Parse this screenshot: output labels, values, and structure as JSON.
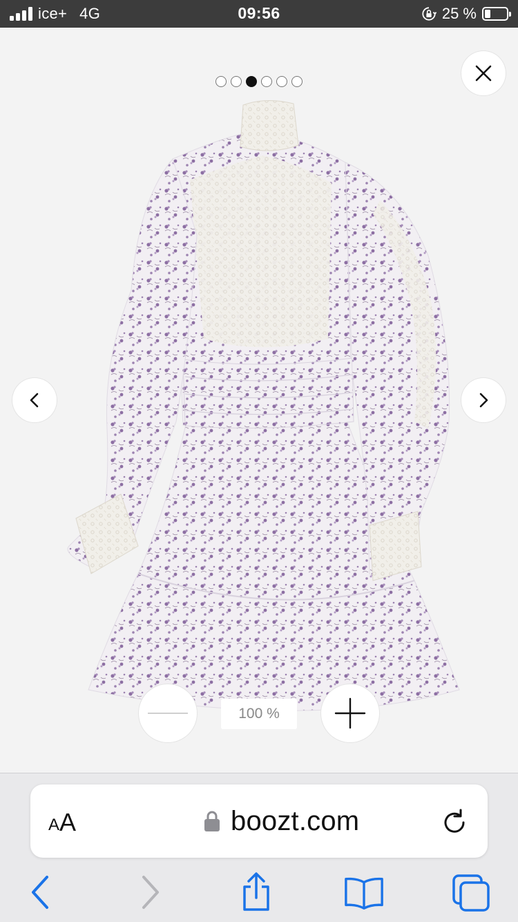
{
  "status_bar": {
    "carrier": "ice+",
    "network": "4G",
    "time": "09:56",
    "battery_text": "25 %",
    "battery_level": 0.25,
    "signal_bars": 4
  },
  "viewer": {
    "image_count": 6,
    "active_index": 2,
    "zoom_level": "100 %",
    "icons": {
      "close": "close-icon",
      "prev": "chevron-left-icon",
      "next": "chevron-right-icon",
      "zoom_out": "minus-icon",
      "zoom_in": "plus-icon"
    }
  },
  "browser": {
    "reader_small": "A",
    "reader_big": "A",
    "url": "boozt.com",
    "accent_color": "#1a73e8",
    "disabled_color": "#b5b5b9"
  },
  "colors": {
    "background": "#f3f3f3",
    "status_bar": "#3c3c3c",
    "toolbar": "#e9e9eb",
    "dress_fabric": "#f2eff3",
    "dress_print": "#8d6fa3"
  }
}
